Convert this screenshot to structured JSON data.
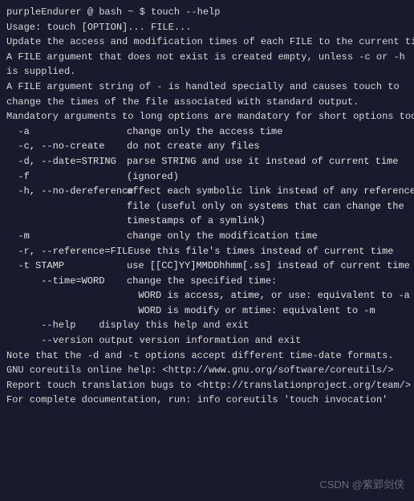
{
  "prompt": "purpleEndurer @ bash ~ $ touch --help",
  "usage": "Usage: touch [OPTION]... FILE...",
  "desc1": "Update the access and modification times of each FILE to the current time.",
  "blank": "",
  "desc2a": "A FILE argument that does not exist is created empty, unless -c or -h",
  "desc2b": "is supplied.",
  "desc3a": "A FILE argument string of - is handled specially and causes touch to",
  "desc3b": "change the times of the file associated with standard output.",
  "mandatory": "Mandatory arguments to long options are mandatory for short options too.",
  "options": {
    "a": {
      "flag": "  -a",
      "desc": "change only the access time"
    },
    "c": {
      "flag": "  -c, --no-create",
      "desc": "do not create any files"
    },
    "d": {
      "flag": "  -d, --date=STRING",
      "desc": "parse STRING and use it instead of current time"
    },
    "f": {
      "flag": "  -f",
      "desc": "(ignored)"
    },
    "h": {
      "flag": "  -h, --no-dereference",
      "desc": "affect each symbolic link instead of any referenced"
    },
    "h2": {
      "flag": "",
      "desc": "file (useful only on systems that can change the"
    },
    "h3": {
      "flag": "",
      "desc": "timestamps of a symlink)"
    },
    "m": {
      "flag": "  -m",
      "desc": "change only the modification time"
    },
    "r": {
      "flag": "  -r, --reference=FILE",
      "desc": "use this file's times instead of current time"
    },
    "t": {
      "flag": "  -t STAMP",
      "desc": "use [[CC]YY]MMDDhhmm[.ss] instead of current time"
    },
    "time": {
      "flag": "      --time=WORD",
      "desc": "change the specified time:"
    },
    "time2": {
      "flag": "",
      "desc": "  WORD is access, atime, or use: equivalent to -a"
    },
    "time3": {
      "flag": "",
      "desc": "  WORD is modify or mtime: equivalent to -m"
    },
    "help": {
      "flag": "      --help",
      "desc": "display this help and exit"
    },
    "version": {
      "flag": "      --version",
      "desc": "output version information and exit"
    }
  },
  "note": "Note that the -d and -t options accept different time-date formats.",
  "footer1": "GNU coreutils online help: <http://www.gnu.org/software/coreutils/>",
  "footer2": "Report touch translation bugs to <http://translationproject.org/team/>",
  "footer3": "For complete documentation, run: info coreutils 'touch invocation'",
  "watermark": "CSDN @紫郢剑侠"
}
